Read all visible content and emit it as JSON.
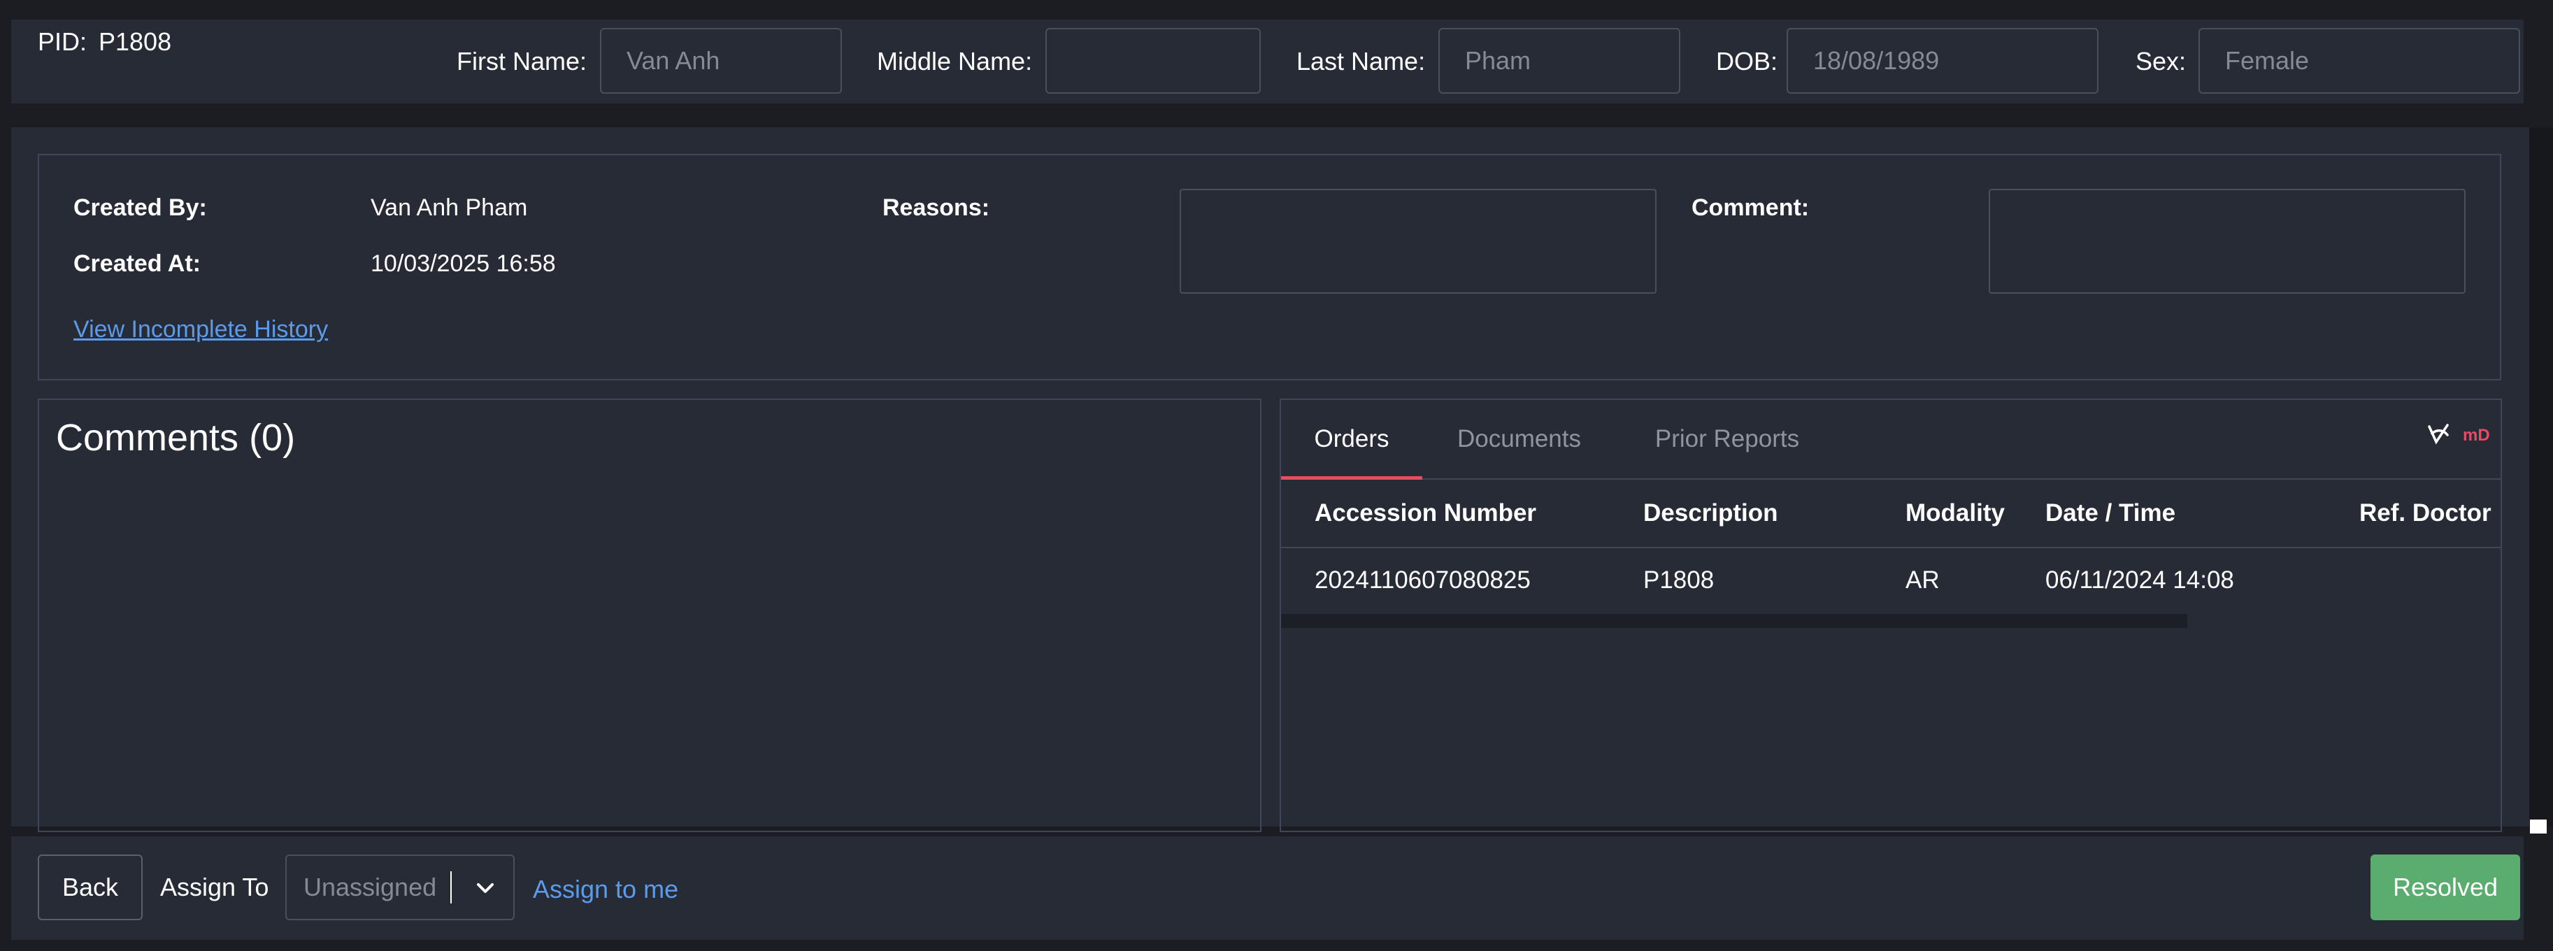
{
  "patient": {
    "pid_label": "PID:",
    "pid_value": "P1808",
    "first_name_label": "First Name:",
    "first_name_value": "Van Anh",
    "middle_name_label": "Middle Name:",
    "middle_name_value": "",
    "last_name_label": "Last Name:",
    "last_name_value": "Pham",
    "dob_label": "DOB:",
    "dob_value": "18/08/1989",
    "sex_label": "Sex:",
    "sex_value": "Female"
  },
  "info": {
    "created_by_label": "Created By:",
    "created_by_value": "Van Anh Pham",
    "created_at_label": "Created At:",
    "created_at_value": "10/03/2025 16:58",
    "reasons_label": "Reasons:",
    "comment_label": "Comment:",
    "history_link": "View Incomplete History"
  },
  "comments": {
    "title": "Comments (0)"
  },
  "orders_panel": {
    "tabs": [
      "Orders",
      "Documents",
      "Prior Reports"
    ],
    "active_tab": "Orders",
    "brand_icon_text": "mD",
    "columns": [
      "Accession Number",
      "Description",
      "Modality",
      "Date / Time",
      "Ref. Doctor"
    ],
    "rows": [
      {
        "accession": "2024110607080825",
        "description": "P1808",
        "modality": "AR",
        "datetime": "06/11/2024 14:08",
        "ref_doctor": ""
      }
    ]
  },
  "footer": {
    "back_label": "Back",
    "assign_to_label": "Assign To",
    "assign_select_value": "Unassigned",
    "assign_to_me_label": "Assign to me",
    "resolved_label": "Resolved"
  },
  "colors": {
    "background": "#1b1d22",
    "panel": "#272b36",
    "link": "#5b9bea",
    "tab_accent": "#e24d63",
    "resolved": "#5aad6e"
  }
}
